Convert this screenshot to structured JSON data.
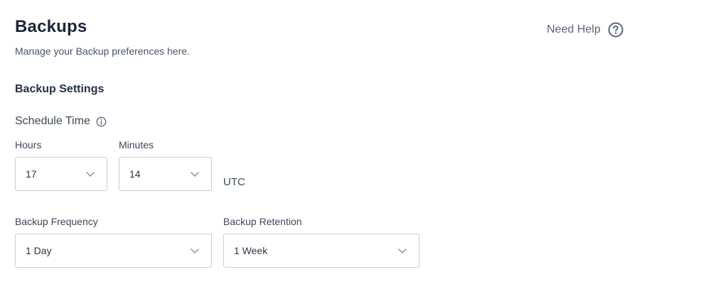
{
  "header": {
    "title": "Backups",
    "subtitle": "Manage your Backup preferences here.",
    "help_label": "Need Help",
    "help_icon": "question-circle-icon"
  },
  "settings": {
    "section_title": "Backup Settings",
    "schedule_label": "Schedule Time",
    "schedule_icon": "info-circle-icon",
    "hours": {
      "label": "Hours",
      "value": "17"
    },
    "minutes": {
      "label": "Minutes",
      "value": "14"
    },
    "timezone": "UTC",
    "frequency": {
      "label": "Backup Frequency",
      "value": "1 Day"
    },
    "retention": {
      "label": "Backup Retention",
      "value": "1 Week"
    }
  },
  "colors": {
    "text_primary": "#1c2536",
    "text_secondary": "#4a5568",
    "border": "#c9ced6",
    "icon": "#5a6679"
  }
}
